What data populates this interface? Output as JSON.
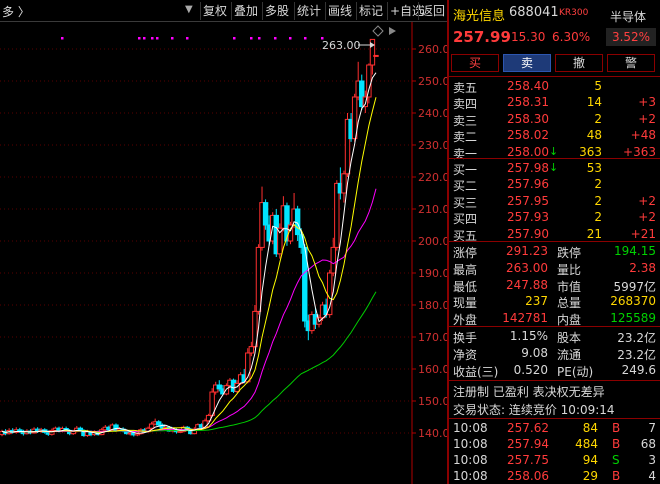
{
  "toolbar": {
    "period": "多 〉",
    "buttons": [
      "复权",
      "叠加",
      "多股",
      "统计",
      "画线",
      "标记",
      "+自选",
      "返回"
    ]
  },
  "chart": {
    "y_axis": {
      "ticks": [
        "140.00",
        "150.0",
        "160.0",
        "170.0",
        "180.0",
        "190.0",
        "200.0",
        "210.0",
        "220.0",
        "230.0",
        "240.0",
        "250.0",
        "260.0"
      ]
    },
    "high_annotation": "263.00",
    "colors": {
      "up": "#ff3030",
      "down": "#00e5ff",
      "ma5": "#ffffff",
      "ma10": "#ffff00",
      "ma20": "#ff00ff",
      "ma60": "#00cc00",
      "marker": "#ff00ff"
    }
  },
  "stock": {
    "name": "海光信息",
    "code": "688041",
    "tag": "KR300",
    "sector": "半导体",
    "last_price": "257.99",
    "change": "15.30",
    "change_pct": "6.30%",
    "sector_change": "3.52%"
  },
  "actions": {
    "buy": "买",
    "sell": "卖",
    "cancel": "撤",
    "alert": "警"
  },
  "orderbook": {
    "asks": [
      {
        "label": "卖五",
        "price": "258.40",
        "vol": "5",
        "delta": ""
      },
      {
        "label": "卖四",
        "price": "258.31",
        "vol": "14",
        "delta": "+3"
      },
      {
        "label": "卖三",
        "price": "258.30",
        "vol": "2",
        "delta": "+2"
      },
      {
        "label": "卖二",
        "price": "258.02",
        "vol": "48",
        "delta": "+48"
      },
      {
        "label": "卖一",
        "price": "258.00",
        "vol": "363",
        "delta": "+363"
      }
    ],
    "bids": [
      {
        "label": "买一",
        "price": "257.98",
        "vol": "53",
        "delta": ""
      },
      {
        "label": "买二",
        "price": "257.96",
        "vol": "2",
        "delta": ""
      },
      {
        "label": "买三",
        "price": "257.95",
        "vol": "2",
        "delta": "+2"
      },
      {
        "label": "买四",
        "price": "257.93",
        "vol": "2",
        "delta": "+2"
      },
      {
        "label": "买五",
        "price": "257.90",
        "vol": "21",
        "delta": "+21"
      }
    ]
  },
  "stats": [
    {
      "l1": "涨停",
      "v1": "291.23",
      "c1": "red",
      "l2": "跌停",
      "v2": "194.15",
      "c2": "green"
    },
    {
      "l1": "最高",
      "v1": "263.00",
      "c1": "red",
      "l2": "量比",
      "v2": "2.38",
      "c2": "red"
    },
    {
      "l1": "最低",
      "v1": "247.88",
      "c1": "red",
      "l2": "市值",
      "v2": "5997亿",
      "c2": "white"
    },
    {
      "l1": "现量",
      "v1": "237",
      "c1": "yellow",
      "l2": "总量",
      "v2": "268370",
      "c2": "yellow"
    },
    {
      "l1": "外盘",
      "v1": "142781",
      "c1": "red",
      "l2": "内盘",
      "v2": "125589",
      "c2": "green"
    }
  ],
  "stats2": [
    {
      "l1": "换手",
      "v1": "1.15%",
      "c1": "white",
      "l2": "股本",
      "v2": "23.2亿",
      "c2": "white"
    },
    {
      "l1": "净资",
      "v1": "9.08",
      "c1": "white",
      "l2": "流通",
      "v2": "23.2亿",
      "c2": "white"
    },
    {
      "l1": "收益(三)",
      "v1": "0.520",
      "c1": "white",
      "l2": "PE(动)",
      "v2": "249.6",
      "c2": "white"
    }
  ],
  "registration": "注册制 已盈利 表决权无差异",
  "trade_status": "交易状态: 连续竞价 10:09:14",
  "ticks": [
    {
      "time": "10:08",
      "price": "257.62",
      "pc": "red",
      "vol": "84",
      "side": "B",
      "sc": "red",
      "count": "7"
    },
    {
      "time": "10:08",
      "price": "257.94",
      "pc": "red",
      "vol": "484",
      "side": "B",
      "sc": "red",
      "count": "68"
    },
    {
      "time": "10:08",
      "price": "257.75",
      "pc": "red",
      "vol": "94",
      "side": "S",
      "sc": "green",
      "count": "3"
    },
    {
      "time": "10:08",
      "price": "258.06",
      "pc": "red",
      "vol": "29",
      "side": "B",
      "sc": "red",
      "count": "4"
    }
  ]
}
